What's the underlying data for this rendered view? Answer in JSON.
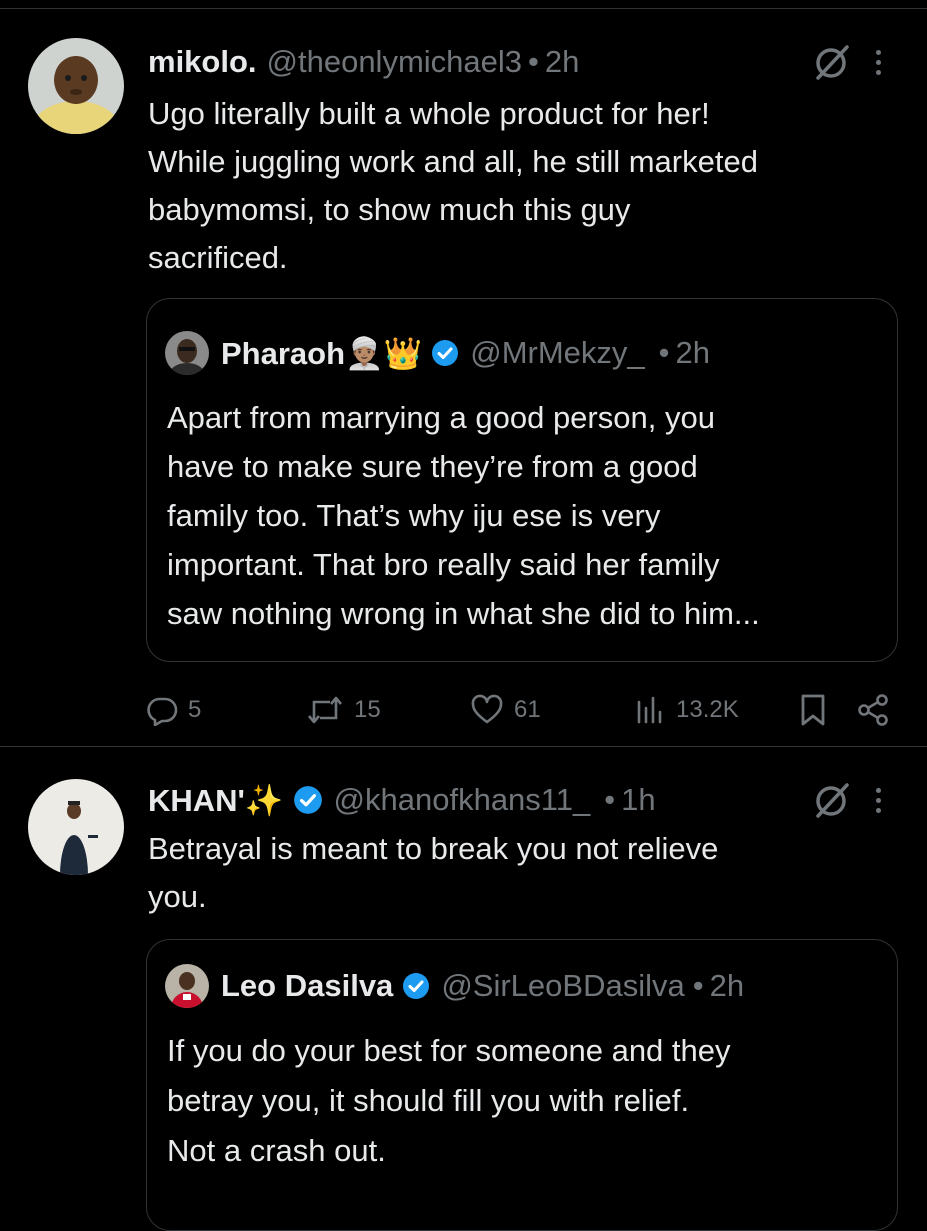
{
  "tweet1": {
    "name": "mikolo.",
    "handle": "@theonlymichael3",
    "dot": "•",
    "time": "2h",
    "lines": [
      "Ugo literally built a whole product for her!",
      "While juggling work and all, he still marketed",
      "babymomsi, to show much this guy",
      "sacrificed."
    ],
    "quote": {
      "name": "Pharaoh👳🏽‍♂️👑",
      "handle": "@MrMekzy_",
      "dot": "•",
      "time": "2h",
      "lines": [
        "Apart from marrying a good person, you",
        "have to make sure they’re from a good",
        "family too. That’s why iju ese is very",
        "important. That bro really said her family",
        "saw nothing wrong in what she did to him..."
      ]
    },
    "actions": {
      "replies": "5",
      "reposts": "15",
      "likes": "61",
      "views": "13.2K"
    }
  },
  "tweet2": {
    "name": "KHAN'✨",
    "handle": "@khanofkhans11_",
    "dot": "•",
    "time": "1h",
    "lines": [
      "Betrayal is meant to break you not relieve",
      "you."
    ],
    "quote": {
      "name": "Leo Dasilva",
      "handle": "@SirLeoBDasilva",
      "dot": "•",
      "time": "2h",
      "lines": [
        "If you do your best for someone and they",
        "betray you, it should fill you with relief.",
        "Not a crash out."
      ]
    }
  },
  "colors": {
    "background": "#000000",
    "text": "#e7e9ea",
    "secondary": "#71767b",
    "verified": "#1d9bf0",
    "border": "#2f3336"
  },
  "icons": {
    "reply": "reply-icon",
    "repost": "repost-icon",
    "like": "heart-icon",
    "views": "views-icon",
    "bookmark": "bookmark-icon",
    "share": "share-icon",
    "grok": "grok-icon",
    "more": "more-icon",
    "verified": "verified-badge-icon"
  }
}
